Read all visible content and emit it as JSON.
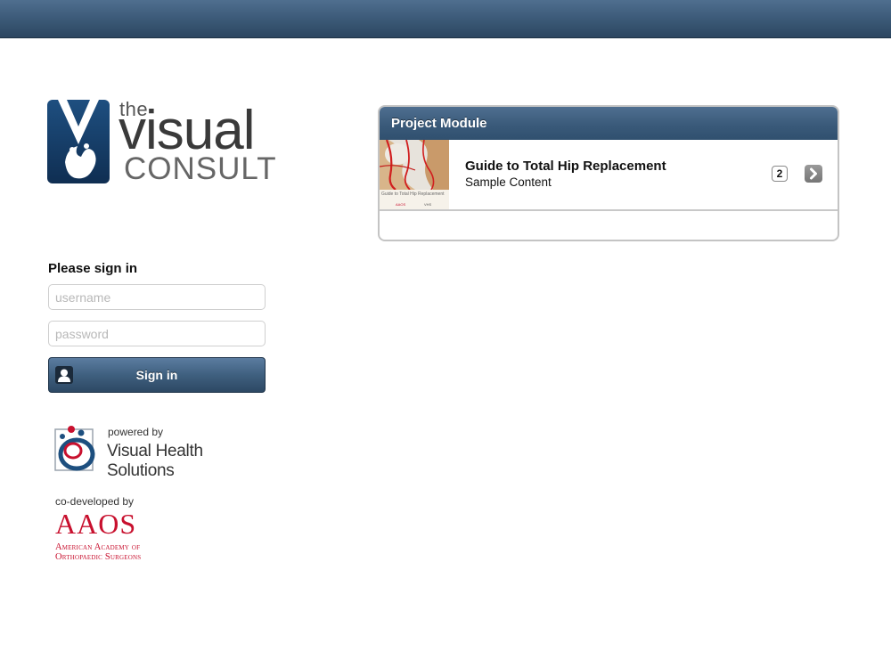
{
  "logo": {
    "the": "the",
    "visual": "visual",
    "consult": "CONSULT"
  },
  "signin": {
    "title": "Please sign in",
    "username_placeholder": "username",
    "password_placeholder": "password",
    "button_label": "Sign in"
  },
  "powered": {
    "label": "powered by",
    "name": "Visual Health Solutions"
  },
  "codeveloped": {
    "label": "co-developed by",
    "org_abbr": "AAOS",
    "org_line1": "American Academy of",
    "org_line2": "Orthopaedic Surgeons"
  },
  "project_module": {
    "header": "Project Module",
    "items": [
      {
        "title": "Guide to Total Hip Replacement",
        "subtitle": "Sample Content",
        "count": "2",
        "thumb_caption": "Guide to Total Hip Replacement",
        "thumb_logo_left": "AAOS",
        "thumb_logo_right": "VHS"
      }
    ]
  },
  "colors": {
    "nav_bar": "#3c5a78",
    "brand_blue": "#1d4f7f",
    "aaos_red": "#c8102e"
  }
}
